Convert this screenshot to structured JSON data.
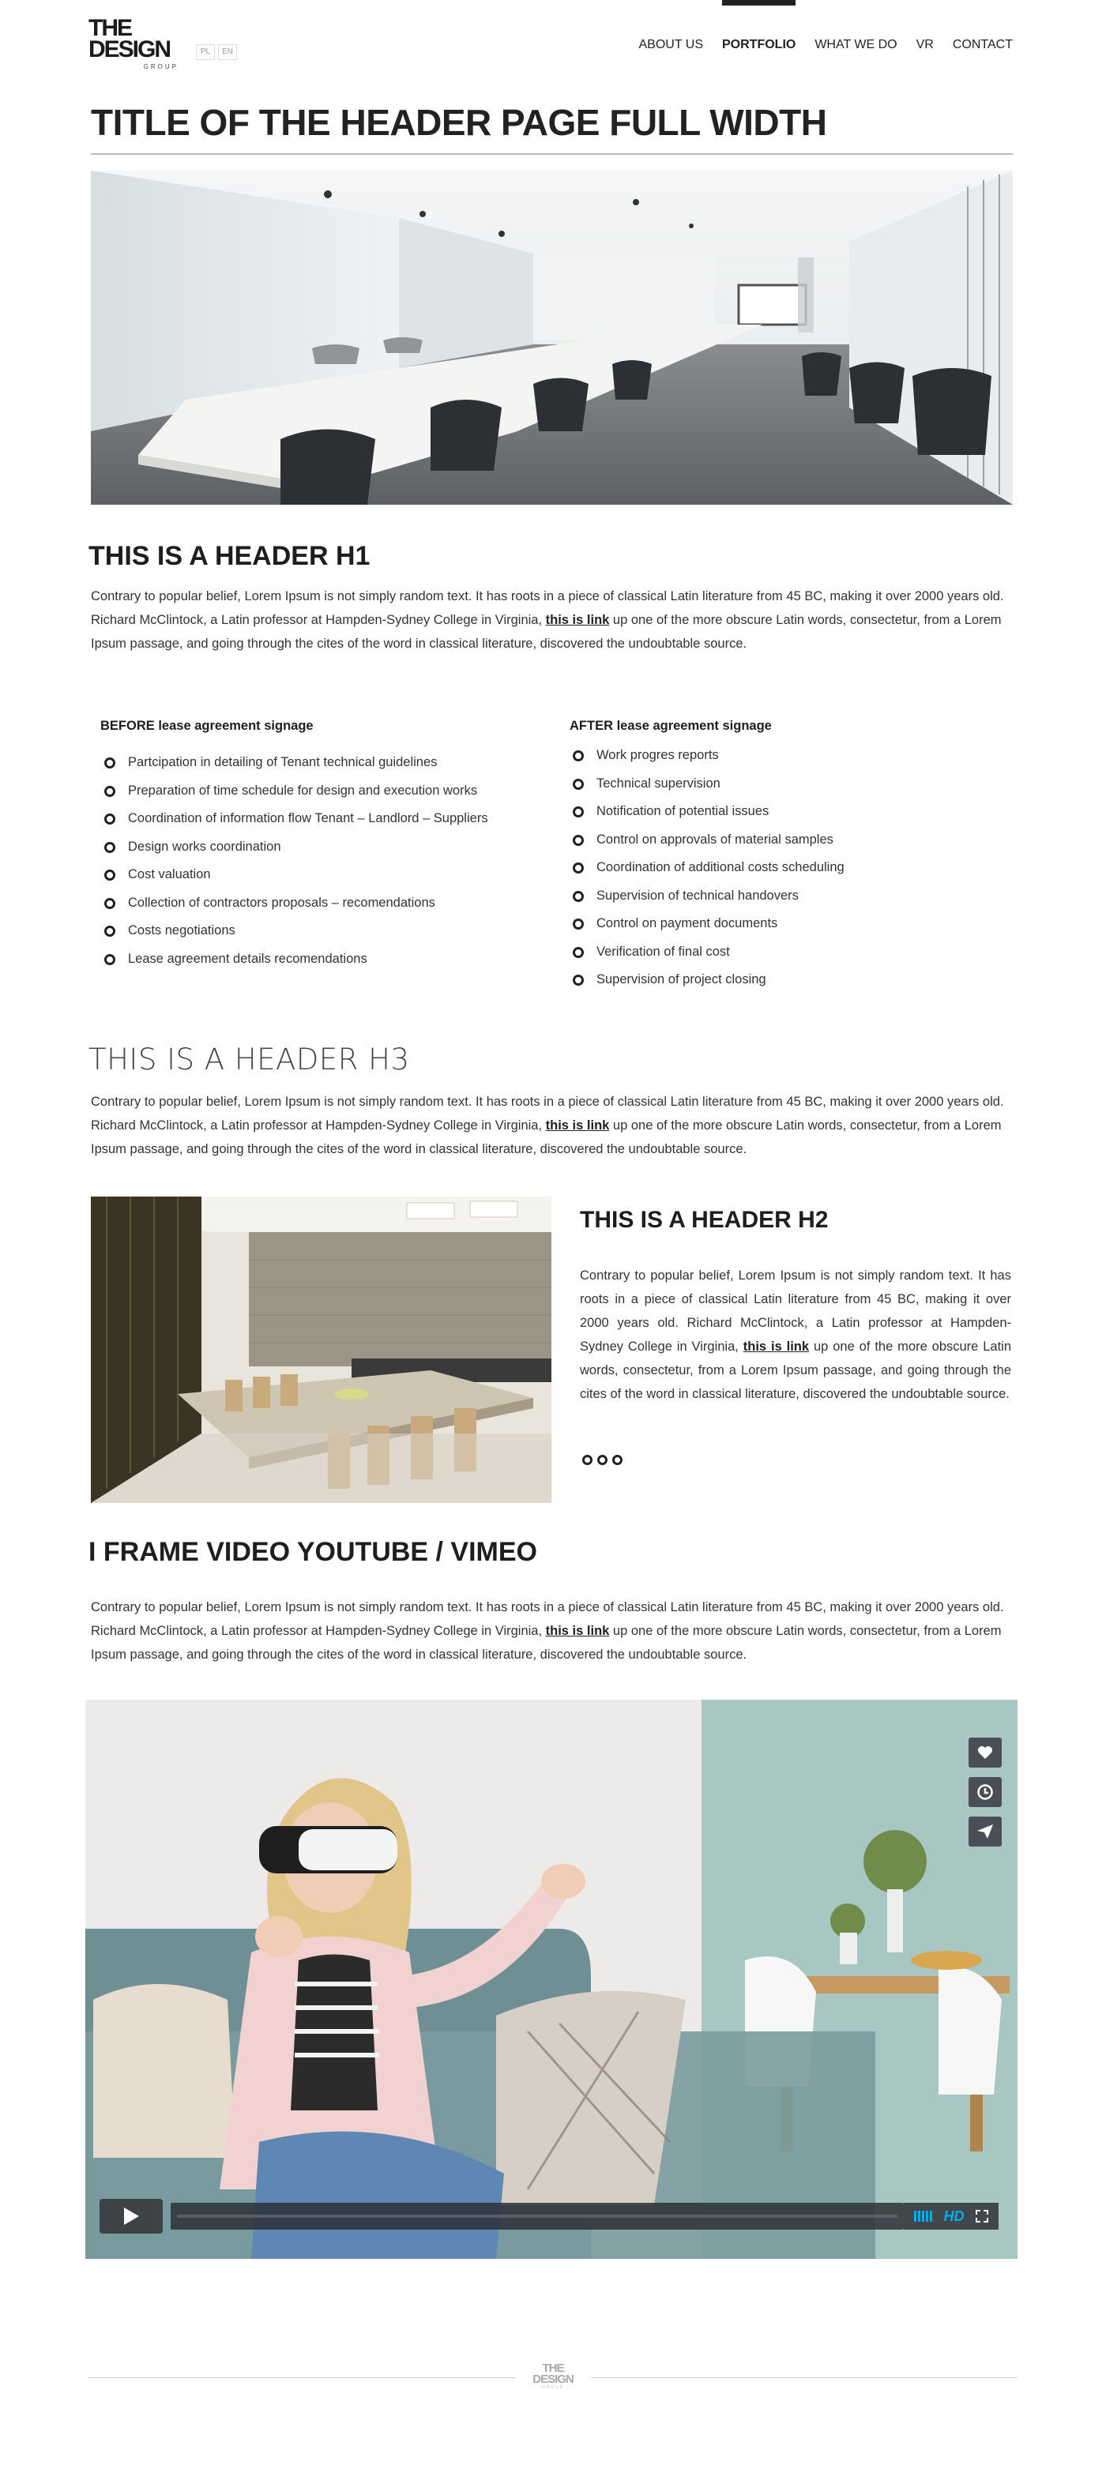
{
  "header": {
    "logo": {
      "line1": "THE",
      "line2": "DESIGN",
      "line3": "GROUP"
    },
    "languages": [
      "PL",
      "EN"
    ],
    "nav": [
      {
        "label": "ABOUT US",
        "active": false
      },
      {
        "label": "PORTFOLIO",
        "active": true
      },
      {
        "label": "WHAT WE DO",
        "active": false
      },
      {
        "label": "VR",
        "active": false
      },
      {
        "label": "CONTACT",
        "active": false
      }
    ]
  },
  "page_title": "TITLE OF THE HEADER PAGE FULL WIDTH",
  "section1": {
    "heading": "THIS IS A HEADER H1",
    "text_before": "Contrary to popular belief, Lorem Ipsum is not simply random text. It has roots in a piece of classical Latin literature from 45 BC, making it over 2000 years old. Richard McClintock, a Latin professor at Hampden-Sydney College in Virginia, ",
    "link": "this is link",
    "text_after": " up one of the more obscure Latin words, consectetur, from a Lorem Ipsum passage, and going through the cites of the word in classical literature, discovered the undoubtable source."
  },
  "lists": {
    "before": {
      "title": "BEFORE lease agreement signage",
      "items": [
        "Partcipation in detailing of Tenant technical guidelines",
        "Preparation of time schedule for design and execution works",
        "Coordination of information flow Tenant – Landlord – Suppliers",
        "Design works coordination",
        "Cost valuation",
        "Collection of contractors proposals – recomendations",
        "Costs negotiations",
        "Lease agreement details recomendations"
      ]
    },
    "after": {
      "title": "AFTER lease agreement signage",
      "items": [
        "Work progres reports",
        "Technical supervision",
        "Notification of potential issues",
        "Control on approvals of material samples",
        "Coordination of additional costs scheduling",
        "Supervision of technical handovers",
        "Control on payment documents",
        "Verification of final cost",
        "Supervision of project closing"
      ]
    }
  },
  "section3": {
    "heading": "THIS IS A HEADER H3",
    "text_before": "Contrary to popular belief, Lorem Ipsum is not simply random text. It has roots in a piece of classical Latin literature from 45 BC, making it over 2000 years old. Richard McClintock, a Latin professor at Hampden-Sydney College in Virginia, ",
    "link": "this is link",
    "text_after": " up one of the more obscure Latin words, consectetur, from a Lorem Ipsum passage, and going through the cites of the word in classical literature, discovered the undoubtable source."
  },
  "section2": {
    "heading": "THIS IS A HEADER H2",
    "text_before": "Contrary to popular belief, Lorem Ipsum is not simply random text. It has roots in a piece of classical Latin literature from 45 BC, making it over 2000 years old. Richard McClintock, a Latin professor at Hampden-Sydney College in Virginia, ",
    "link": "this is link",
    "text_after": " up one of the more obscure Latin words, consectetur, from a Lorem Ipsum passage, and going through the cites of the word in classical literature, discovered the undoubtable source."
  },
  "iframe_section": {
    "heading": "I FRAME VIDEO YOUTUBE / VIMEO",
    "text_before": "Contrary to popular belief, Lorem Ipsum is not simply random text. It has roots in a piece of classical Latin literature from 45 BC, making it over 2000 years old. Richard McClintock, a Latin professor at Hampden-Sydney College in Virginia, ",
    "link": "this is link",
    "text_after": " up one of the more obscure Latin words, consectetur, from a Lorem Ipsum passage, and going through the cites of the word in classical literature, discovered the undoubtable source."
  },
  "video": {
    "hd_label": "HD",
    "side_icons": [
      "heart-icon",
      "clock-icon",
      "send-icon"
    ],
    "accent": "#00adef",
    "progress": 0
  },
  "footer": {
    "logo": {
      "line1": "THE",
      "line2": "DESIGN",
      "line3": "GROUP"
    }
  }
}
